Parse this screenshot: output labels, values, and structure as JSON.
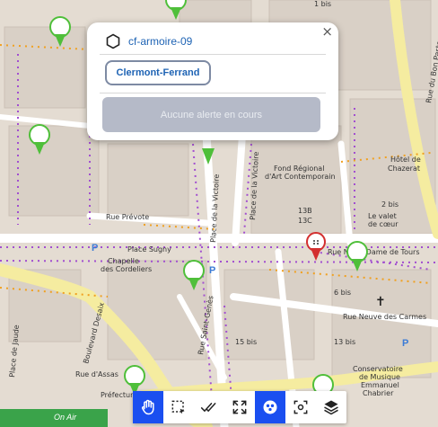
{
  "popup": {
    "close_label": "×",
    "title": "cf-armoire-09",
    "city_button": "Clermont-Ferrand",
    "alert_status": "Aucune alerte en cours"
  },
  "map": {
    "labels": {
      "rue_prevote": "Rue Prévote",
      "place_sugny": "Place Sugny",
      "chapelle_1": "Chapelle",
      "chapelle_2": "des Cordeliers",
      "place_de_la_victoire_v": "Place de la Victoire",
      "fond_regional_1": "Fond Régional",
      "fond_regional_2": "d'Art Contemporain",
      "hotel_1": "Hôtel de",
      "hotel_2": "Chazerat",
      "valet_1": "Le valet",
      "valet_2": "de cœur",
      "rue_tours": "Rue Notre-Dame de Tours",
      "rue_carmes": "Rue Neuve des Carmes",
      "boulevard_desaix": "Boulevard Desaix",
      "rue_saint_genes": "Rue Saint-Genès",
      "place_de_jaude": "Place de Jaude",
      "rue_assas": "Rue d'Assas",
      "prefecture": "Préfecture",
      "conservatoire_1": "Conservatoire",
      "conservatoire_2": "de Musique",
      "conservatoire_3": "Emmanuel",
      "conservatoire_4": "Chabrier",
      "rue_bon_pasteur": "Rue du Bon Pasteur",
      "place_victoire_2": "Place de la Victoire",
      "on_air": "On Air",
      "num_13b": "13B",
      "num_13c": "13C",
      "num_15bis": "15 bis",
      "num_13bis": "13 bis",
      "num_6bis": "6 bis",
      "num_1bis": "1 bis",
      "num_2bis": "2 bis"
    }
  },
  "toolbar": {
    "items": [
      "pan-tool",
      "box-select",
      "validate",
      "fullscreen",
      "cluster",
      "focus",
      "layers"
    ],
    "active_index": 0
  },
  "colors": {
    "marker_green": "#4fbf3a",
    "marker_red": "#d32f2f",
    "toolbar_active": "#1a4ff0",
    "link_blue": "#1e63b4"
  }
}
